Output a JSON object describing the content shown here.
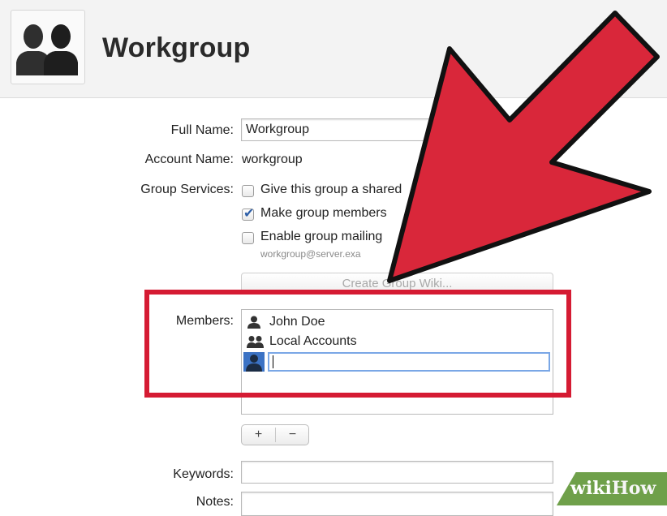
{
  "header": {
    "title": "Workgroup",
    "icon": "group-users-icon"
  },
  "form": {
    "full_name_label": "Full Name:",
    "full_name_value": "Workgroup",
    "account_name_label": "Account Name:",
    "account_name_value": "workgroup",
    "group_services_label": "Group Services:",
    "services": [
      {
        "label": "Give this group a shared",
        "checked": false
      },
      {
        "label": "Make group members",
        "checked": true
      },
      {
        "label": "Enable group mailing",
        "checked": false
      }
    ],
    "mailing_address": "workgroup@server.exa",
    "create_wiki_button": "Create Group Wiki...",
    "members_label": "Members:",
    "members": [
      {
        "name": "John Doe",
        "icon": "user-icon"
      },
      {
        "name": "Local Accounts",
        "icon": "group-icon"
      }
    ],
    "new_member_value": "",
    "add_button": "+",
    "remove_button": "−",
    "keywords_label": "Keywords:",
    "keywords_value": "",
    "notes_label": "Notes:"
  },
  "overlay": {
    "arrow_color": "#d9273a",
    "highlight_color": "#d51b33",
    "watermark_wiki": "wiki",
    "watermark_how": "How"
  }
}
